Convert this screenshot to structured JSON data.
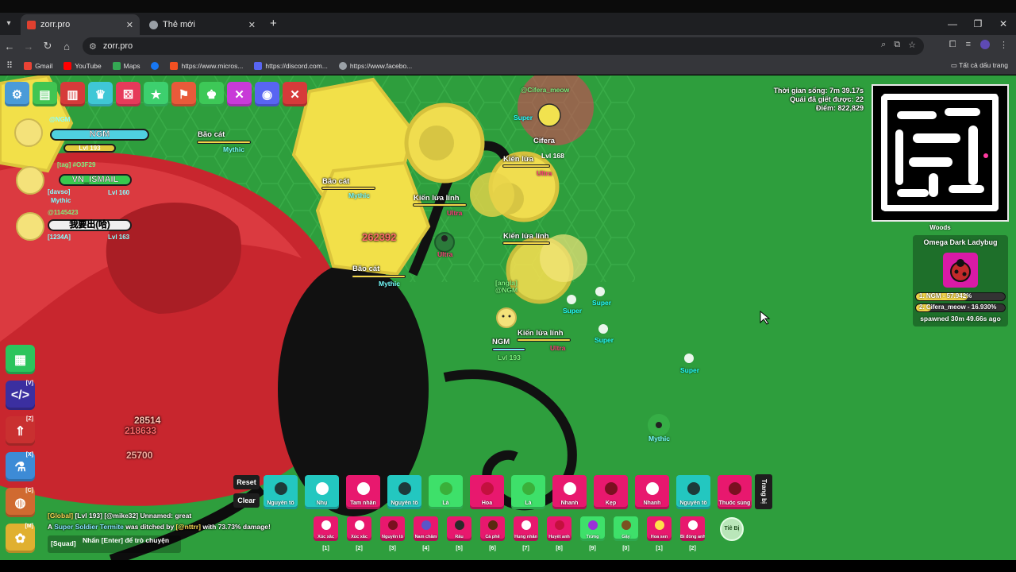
{
  "browser": {
    "tabs": [
      {
        "label": "zorr.pro",
        "active": true,
        "favicon_color": "#e0402f"
      },
      {
        "label": "Thẻ mới",
        "active": false,
        "favicon_color": "#9aa0a6"
      }
    ],
    "url": "zorr.pro",
    "bookmarks": [
      {
        "label": "Gmail",
        "color": "#ea4335"
      },
      {
        "label": "YouTube",
        "color": "#ff0000"
      },
      {
        "label": "Maps",
        "color": "#34a853"
      },
      {
        "label": "https://www.micros...",
        "color": "#f25022"
      },
      {
        "label": "https://discord.com...",
        "color": "#5865f2"
      },
      {
        "label": "https://www.facebo...",
        "color": "#9aa0a6"
      }
    ],
    "all_bookmarks": "Tất cả dấu trang"
  },
  "hud": {
    "toolbar_icons": [
      "gear-icon",
      "inventory-icon",
      "stats-icon",
      "trophy-icon",
      "dice-icon",
      "star-icon",
      "flag-icon",
      "crown-icon",
      "tools-icon",
      "discord-icon",
      "close-icon"
    ],
    "stats": {
      "time_alive": "Thời gian sống: 7m 39.17s",
      "mobs_killed": "Quái đã giết được: 22",
      "score": "Điểm: 822,829"
    },
    "zone": "Woods",
    "boss": {
      "title": "Omega Dark Ladybug",
      "rank1": "1. NGM - 57.942%",
      "rank2": "2. Cifera_meow - 16.930%",
      "spawned": "spawned 30m 49.66s ago",
      "rank1_fraction": 0.579,
      "rank2_fraction": 0.169
    }
  },
  "squad": [
    {
      "tag": "@NGM",
      "name": "NGM",
      "level_text": "Lvl 193",
      "name_color": "#4fd0e0",
      "bar_fraction": 1.0
    },
    {
      "tag": "[tag] #O3F29",
      "name": "VN_ISMAIL",
      "subtag": "[davso]",
      "rarity": "Mythic",
      "level_text": "Lvl 160",
      "name_color": "#38c94e",
      "bar_fraction": 0.55
    },
    {
      "tag": "@1145423",
      "name": "我要出(哈)",
      "subtag": "[1234A]",
      "level_text": "Lvl 163",
      "name_color": "#f0f0f0",
      "bar_fraction": 0.7
    }
  ],
  "side_buttons": [
    {
      "icon": "shop-icon",
      "key": "",
      "color": "#2cc45d"
    },
    {
      "icon": "code-icon",
      "key": "[V]",
      "color": "#3b2fa0"
    },
    {
      "icon": "upgrade-icon",
      "key": "[Z]",
      "color": "#c93030"
    },
    {
      "icon": "potion-icon",
      "key": "[X]",
      "color": "#3d8bd6"
    },
    {
      "icon": "craft-icon",
      "key": "[C]",
      "color": "#d06a30"
    },
    {
      "icon": "paw-icon",
      "key": "[M]",
      "color": "#e0b030"
    }
  ],
  "entities": [
    {
      "name": "Bão cát",
      "rarity": "Mythic"
    },
    {
      "name": "Bão cát",
      "rarity": "Mythic"
    },
    {
      "name": "Bão cát",
      "rarity": "Mythic"
    },
    {
      "name": "Kiến lửa lính",
      "rarity": "Ultra"
    },
    {
      "name": "Kiến lửa",
      "rarity": "Ultra"
    },
    {
      "name": "Kiến lửa lính",
      "rarity": "Ultra"
    },
    {
      "name": "Kiến lửa lính",
      "rarity": "Ultra"
    },
    {
      "name": "Cifera",
      "rarity": "Lvl 168"
    },
    {
      "name": "@Cifera_meow",
      "rarity": "Super"
    }
  ],
  "player": {
    "tag": "[angla] @NGM",
    "name": "NGM",
    "level": "Lvl 193"
  },
  "drops": [
    "Super",
    "Super",
    "Super",
    "Super",
    "Mythic",
    "Ultra"
  ],
  "damage_numbers": [
    "262392",
    "28514",
    "218633",
    "25700"
  ],
  "controls": {
    "reset": "Reset",
    "clear": "Clear",
    "trang_bi": "Trang bị",
    "tie_bi": "Tiê Bị"
  },
  "loadout": [
    {
      "label": "Nguyên tố",
      "color": "#23c7c0",
      "icon": "#1d3a3a"
    },
    {
      "label": "Nhụ",
      "color": "#23c7c0",
      "icon": "#ffffff"
    },
    {
      "label": "Tam nhãn",
      "color": "#e8186e",
      "icon": "#ffffff"
    },
    {
      "label": "Nguyên tố",
      "color": "#23c7c0",
      "icon": "#1d3a3a"
    },
    {
      "label": "Lá",
      "color": "#3ee06a",
      "icon": "#3ab03a"
    },
    {
      "label": "Hoa",
      "color": "#e8186e",
      "icon": "#c3103e"
    },
    {
      "label": "Lá",
      "color": "#3ee06a",
      "icon": "#3ab03a"
    },
    {
      "label": "Nhanh",
      "color": "#e8186e",
      "icon": "#ffffff"
    },
    {
      "label": "Kẹp",
      "color": "#e8186e",
      "icon": "#7a1020"
    },
    {
      "label": "Nhanh",
      "color": "#e8186e",
      "icon": "#ffffff"
    },
    {
      "label": "Nguyên tố",
      "color": "#23c7c0",
      "icon": "#1d3a3a"
    },
    {
      "label": "Thuốc súng",
      "color": "#e8186e",
      "icon": "#7a1020"
    }
  ],
  "secondary": [
    {
      "label": "Xúc xắc",
      "key": "[1]",
      "color": "#e8186e",
      "icon": "#ffffff"
    },
    {
      "label": "Xúc xắc",
      "key": "[2]",
      "color": "#e8186e",
      "icon": "#ffffff"
    },
    {
      "label": "Nguyên tố",
      "key": "[3]",
      "color": "#e8186e",
      "icon": "#7a1020"
    },
    {
      "label": "Nam châm",
      "key": "[4]",
      "color": "#e8186e",
      "icon": "#5a55c8"
    },
    {
      "label": "Râu",
      "key": "[5]",
      "color": "#e8186e",
      "icon": "#2a2a2a"
    },
    {
      "label": "Cà phê",
      "key": "[6]",
      "color": "#e8186e",
      "icon": "#5a2a10"
    },
    {
      "label": "Hung nhân",
      "key": "[7]",
      "color": "#e8186e",
      "icon": "#ffffff"
    },
    {
      "label": "Huyết anh",
      "key": "[8]",
      "color": "#e8186e",
      "icon": "#c3103e"
    },
    {
      "label": "Trứng",
      "key": "[9]",
      "color": "#3ee06a",
      "icon": "#9a30d8"
    },
    {
      "label": "Gậy",
      "key": "[0]",
      "color": "#3ee06a",
      "icon": "#7a5020"
    },
    {
      "label": "Hoa sen",
      "key": "[1]",
      "color": "#e8186e",
      "icon": "#ffe14a"
    },
    {
      "label": "Bi đồng anh",
      "key": "[2]",
      "color": "#e8186e",
      "icon": "#ffffff"
    }
  ],
  "chat": {
    "line1_channel": "[Global]",
    "line1_text": " [Lvl 193] [@mike32] Unnamed: great",
    "line2_a": "A ",
    "line2_mob": "Super Soldier Termite",
    "line2_b": " was ditched by ",
    "line2_user": "[@nttrr]",
    "line2_c": " with 73.73% damage!",
    "input_channel": "[Squad]",
    "input_placeholder": "Nhấn [Enter] để trò chuyện"
  }
}
